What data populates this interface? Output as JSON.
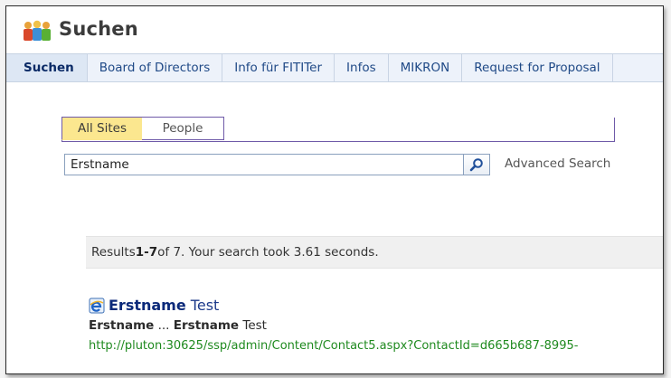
{
  "site": {
    "title": "Suchen",
    "logo_icon": "people-group-icon"
  },
  "nav": {
    "tabs": [
      {
        "label": "Suchen",
        "active": true
      },
      {
        "label": "Board of Directors"
      },
      {
        "label": "Info für FITITer"
      },
      {
        "label": "Infos"
      },
      {
        "label": "MIKRON"
      },
      {
        "label": "Request for Proposal"
      }
    ]
  },
  "search": {
    "scopes": [
      {
        "label": "All Sites",
        "active": true
      },
      {
        "label": "People"
      }
    ],
    "query": "Erstname",
    "button_icon": "magnifier-icon",
    "advanced_label": "Advanced Search"
  },
  "results": {
    "summary_prefix": "Results ",
    "range": "1-7",
    "summary_middle": " of 7. Your search took 3.61 seconds.",
    "items": [
      {
        "icon": "ie-document-icon",
        "title_match": "Erstname",
        "title_rest": " Test",
        "snippet_match1": "Erstname",
        "snippet_sep": " ... ",
        "snippet_match2": "Erstname",
        "snippet_rest": " Test",
        "url": "http://pluton:30625/ssp/admin/Content/Contact5.aspx?ContactId=d665b687-8995-"
      }
    ]
  },
  "colors": {
    "accent_purple": "#6f5aa8",
    "active_scope_bg": "#fbe78f",
    "nav_bg": "#edf2fa",
    "link_blue": "#1c3a8a",
    "url_green": "#1f8a1f"
  }
}
